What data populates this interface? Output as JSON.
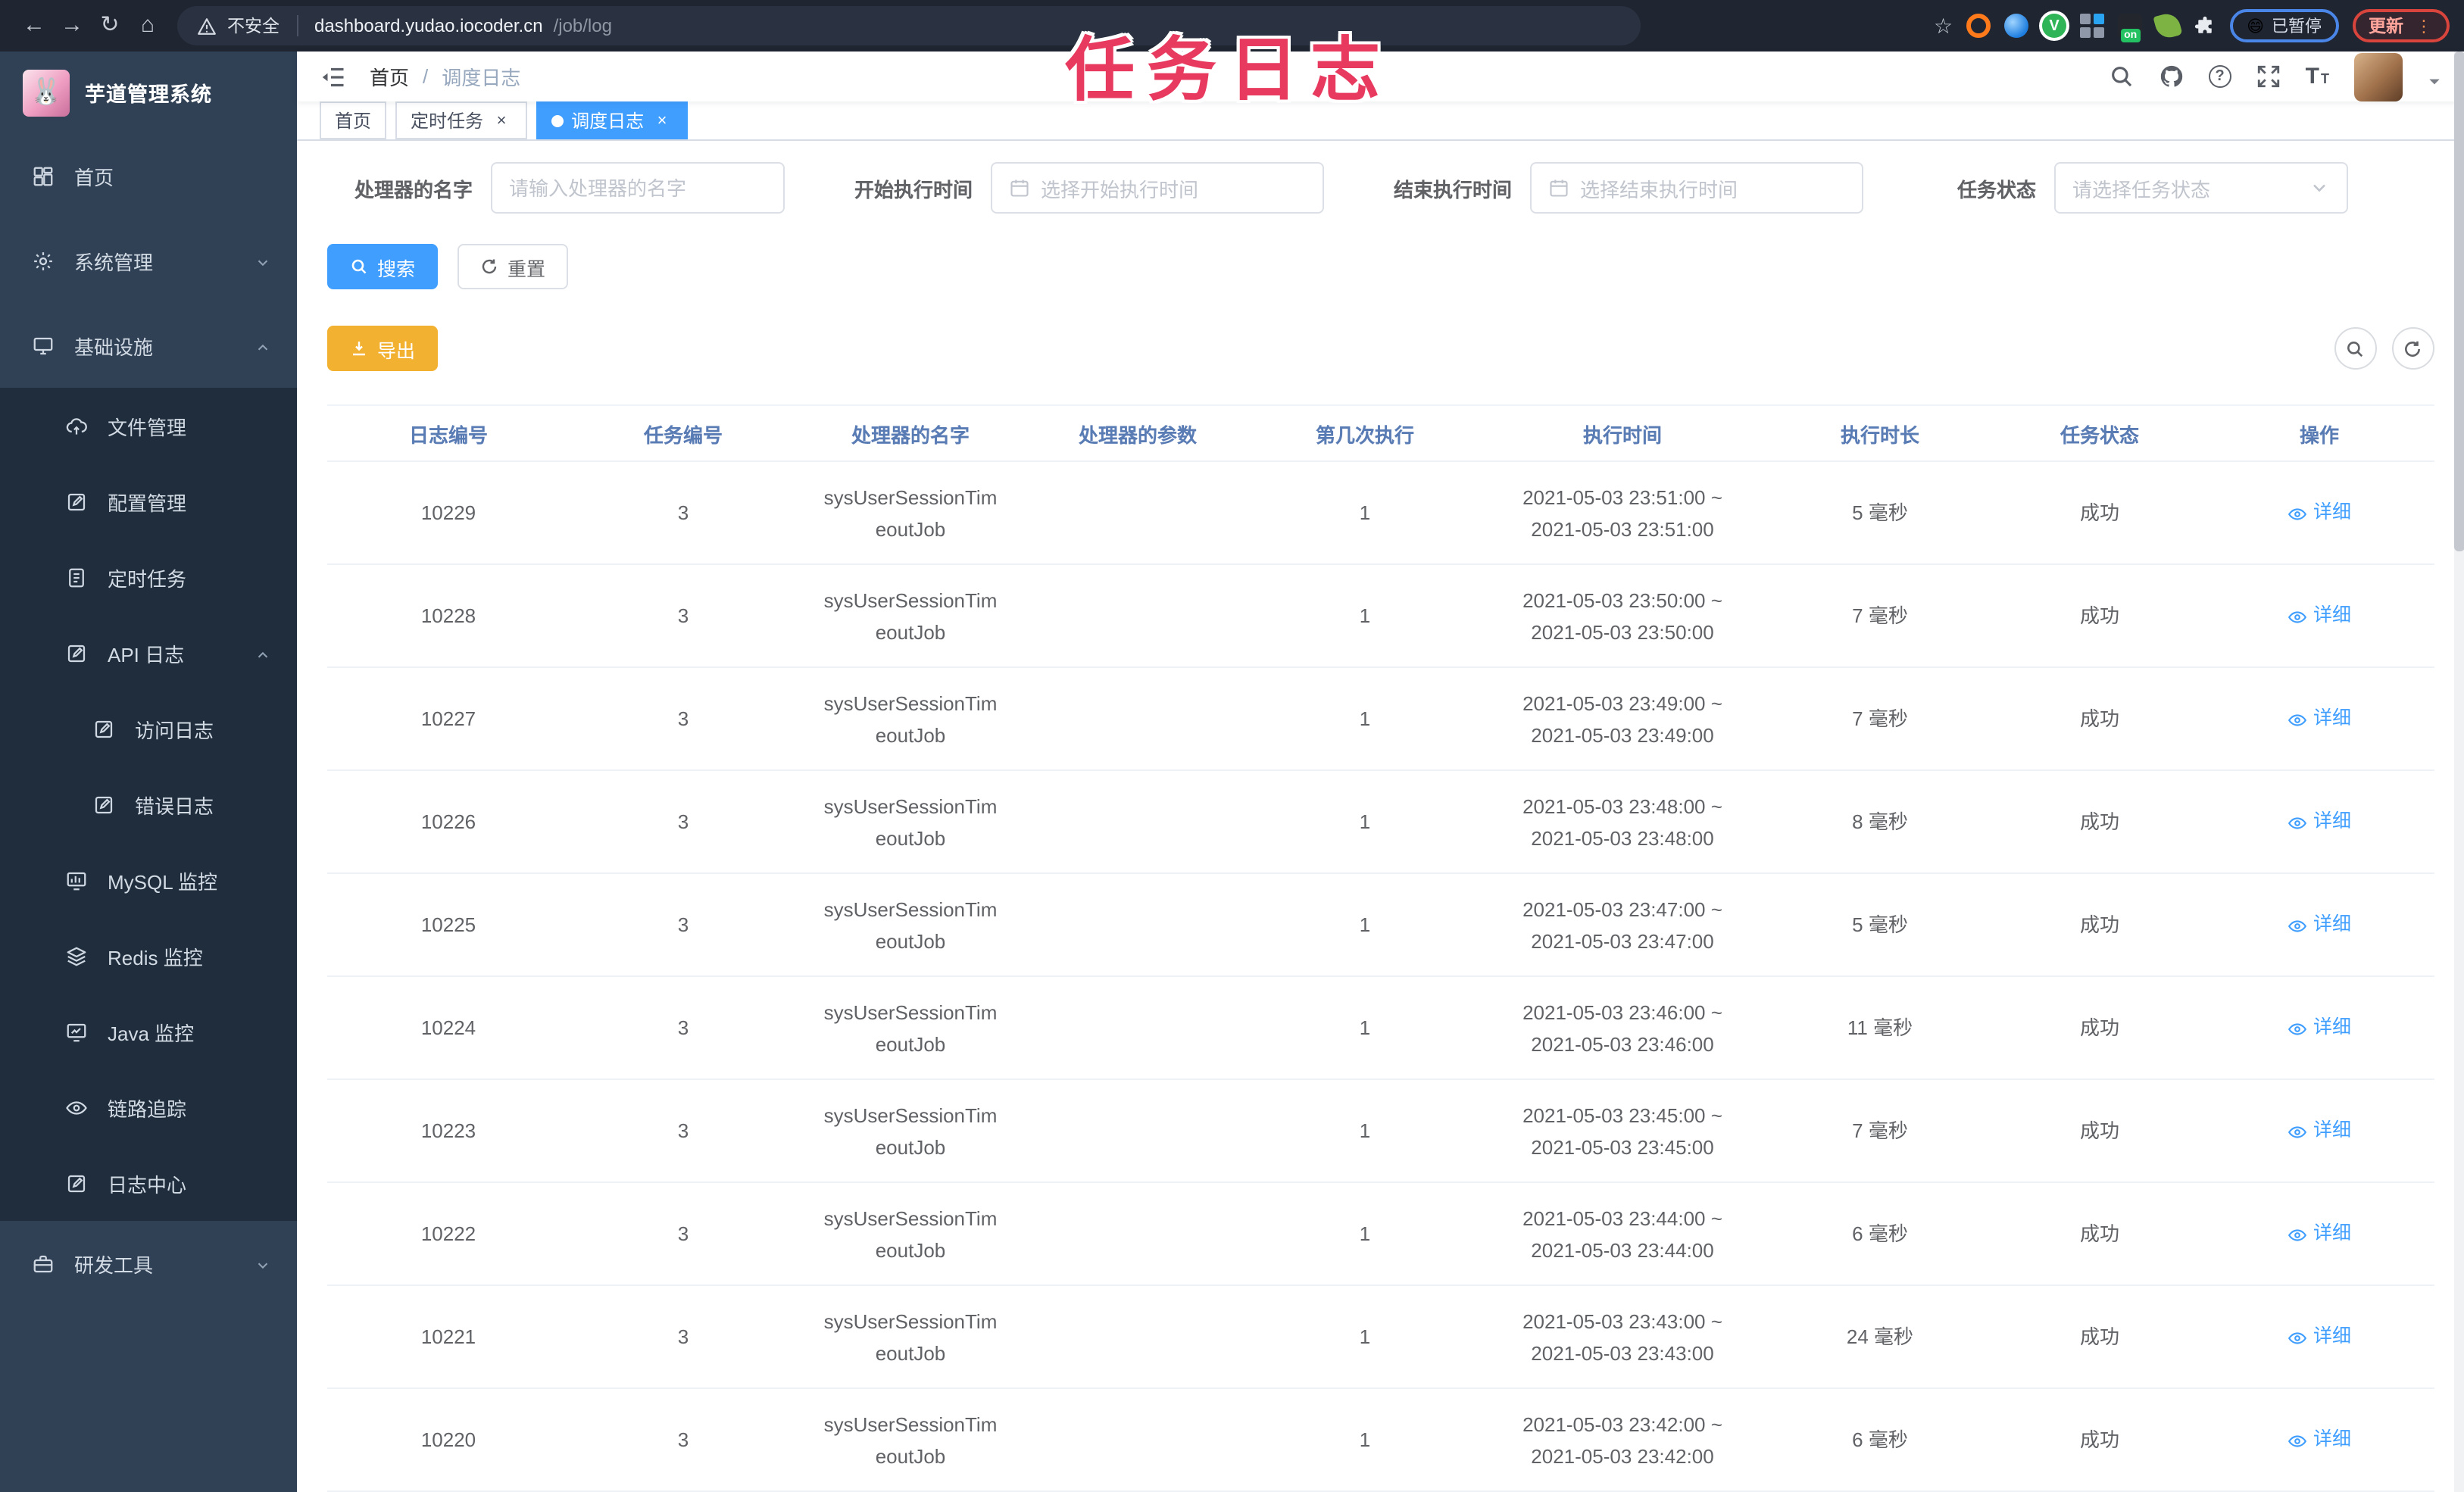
{
  "browser": {
    "security_label": "不安全",
    "url_host": "dashboard.yudao.iocoder.cn",
    "url_path": "/job/log",
    "extension_on_badge": "on",
    "paused_emoji": "😄",
    "paused_label": "已暂停",
    "update_label": "更新",
    "menu_dots": "⋮",
    "back": "←",
    "forward": "→",
    "reload": "↻",
    "home": "⌂",
    "star": "☆"
  },
  "annotation": {
    "text": "任务日志",
    "color": "#e83a5f"
  },
  "colors": {
    "accent": "#409eff",
    "warning_button": "#f2b130",
    "sidebar_bg": "#304156",
    "submenu_bg": "#1f2d3d",
    "table_header_text": "#5a7cb5"
  },
  "sidebar": {
    "logo_emoji": "🐰",
    "title": "芋道管理系统",
    "items": [
      {
        "key": "home",
        "label": "首页",
        "icon": "dashboard",
        "level": 1
      },
      {
        "key": "system",
        "label": "系统管理",
        "icon": "gear",
        "level": 1,
        "chevron": "down"
      },
      {
        "key": "infra",
        "label": "基础设施",
        "icon": "monitor",
        "level": 1,
        "chevron": "up"
      },
      {
        "key": "file",
        "label": "文件管理",
        "icon": "cloud",
        "level": 2
      },
      {
        "key": "config",
        "label": "配置管理",
        "icon": "edit",
        "level": 2
      },
      {
        "key": "job",
        "label": "定时任务",
        "icon": "doc",
        "level": 2
      },
      {
        "key": "api-log",
        "label": "API 日志",
        "icon": "edit",
        "level": 2,
        "chevron": "up"
      },
      {
        "key": "access-log",
        "label": "访问日志",
        "icon": "edit",
        "level": 3
      },
      {
        "key": "error-log",
        "label": "错误日志",
        "icon": "edit",
        "level": 3
      },
      {
        "key": "mysql",
        "label": "MySQL 监控",
        "icon": "chart",
        "level": 2
      },
      {
        "key": "redis",
        "label": "Redis 监控",
        "icon": "layers",
        "level": 2
      },
      {
        "key": "java",
        "label": "Java 监控",
        "icon": "javamon",
        "level": 2
      },
      {
        "key": "trace",
        "label": "链路追踪",
        "icon": "eye",
        "level": 2
      },
      {
        "key": "log-center",
        "label": "日志中心",
        "icon": "edit",
        "level": 2
      },
      {
        "key": "dev-tools",
        "label": "研发工具",
        "icon": "toolbox",
        "level": 1,
        "chevron": "down"
      }
    ]
  },
  "topbar": {
    "breadcrumb": [
      "首页",
      "调度日志"
    ],
    "breadcrumb_sep": "/"
  },
  "tabs": [
    {
      "key": "home",
      "label": "首页",
      "active": false,
      "closable": false
    },
    {
      "key": "job",
      "label": "定时任务",
      "active": false,
      "closable": true
    },
    {
      "key": "job-log",
      "label": "调度日志",
      "active": true,
      "closable": true
    }
  ],
  "filters": {
    "fields": [
      {
        "key": "handler-name",
        "label": "处理器的名字",
        "placeholder": "请输入处理器的名字",
        "type": "text",
        "value": ""
      },
      {
        "key": "begin-time",
        "label": "开始执行时间",
        "placeholder": "选择开始执行时间",
        "type": "date",
        "value": ""
      },
      {
        "key": "end-time",
        "label": "结束执行时间",
        "placeholder": "选择结束执行时间",
        "type": "date",
        "value": ""
      },
      {
        "key": "status",
        "label": "任务状态",
        "placeholder": "请选择任务状态",
        "type": "select",
        "value": ""
      }
    ],
    "search_label": "搜索",
    "reset_label": "重置",
    "export_label": "导出"
  },
  "table": {
    "columns": [
      "日志编号",
      "任务编号",
      "处理器的名字",
      "处理器的参数",
      "第几次执行",
      "执行时间",
      "执行时长",
      "任务状态",
      "操作"
    ],
    "action_label": "详细",
    "rows": [
      {
        "log_id": "10229",
        "task_id": "3",
        "handler": [
          "sysUserSessionTim",
          "eoutJob"
        ],
        "param": "",
        "count": "1",
        "time": [
          "2021-05-03 23:51:00 ~",
          "2021-05-03 23:51:00"
        ],
        "duration": "5 毫秒",
        "status": "成功"
      },
      {
        "log_id": "10228",
        "task_id": "3",
        "handler": [
          "sysUserSessionTim",
          "eoutJob"
        ],
        "param": "",
        "count": "1",
        "time": [
          "2021-05-03 23:50:00 ~",
          "2021-05-03 23:50:00"
        ],
        "duration": "7 毫秒",
        "status": "成功"
      },
      {
        "log_id": "10227",
        "task_id": "3",
        "handler": [
          "sysUserSessionTim",
          "eoutJob"
        ],
        "param": "",
        "count": "1",
        "time": [
          "2021-05-03 23:49:00 ~",
          "2021-05-03 23:49:00"
        ],
        "duration": "7 毫秒",
        "status": "成功"
      },
      {
        "log_id": "10226",
        "task_id": "3",
        "handler": [
          "sysUserSessionTim",
          "eoutJob"
        ],
        "param": "",
        "count": "1",
        "time": [
          "2021-05-03 23:48:00 ~",
          "2021-05-03 23:48:00"
        ],
        "duration": "8 毫秒",
        "status": "成功"
      },
      {
        "log_id": "10225",
        "task_id": "3",
        "handler": [
          "sysUserSessionTim",
          "eoutJob"
        ],
        "param": "",
        "count": "1",
        "time": [
          "2021-05-03 23:47:00 ~",
          "2021-05-03 23:47:00"
        ],
        "duration": "5 毫秒",
        "status": "成功"
      },
      {
        "log_id": "10224",
        "task_id": "3",
        "handler": [
          "sysUserSessionTim",
          "eoutJob"
        ],
        "param": "",
        "count": "1",
        "time": [
          "2021-05-03 23:46:00 ~",
          "2021-05-03 23:46:00"
        ],
        "duration": "11 毫秒",
        "status": "成功"
      },
      {
        "log_id": "10223",
        "task_id": "3",
        "handler": [
          "sysUserSessionTim",
          "eoutJob"
        ],
        "param": "",
        "count": "1",
        "time": [
          "2021-05-03 23:45:00 ~",
          "2021-05-03 23:45:00"
        ],
        "duration": "7 毫秒",
        "status": "成功"
      },
      {
        "log_id": "10222",
        "task_id": "3",
        "handler": [
          "sysUserSessionTim",
          "eoutJob"
        ],
        "param": "",
        "count": "1",
        "time": [
          "2021-05-03 23:44:00 ~",
          "2021-05-03 23:44:00"
        ],
        "duration": "6 毫秒",
        "status": "成功"
      },
      {
        "log_id": "10221",
        "task_id": "3",
        "handler": [
          "sysUserSessionTim",
          "eoutJob"
        ],
        "param": "",
        "count": "1",
        "time": [
          "2021-05-03 23:43:00 ~",
          "2021-05-03 23:43:00"
        ],
        "duration": "24 毫秒",
        "status": "成功"
      },
      {
        "log_id": "10220",
        "task_id": "3",
        "handler": [
          "sysUserSessionTim",
          "eoutJob"
        ],
        "param": "",
        "count": "1",
        "time": [
          "2021-05-03 23:42:00 ~",
          "2021-05-03 23:42:00"
        ],
        "duration": "6 毫秒",
        "status": "成功"
      }
    ]
  }
}
